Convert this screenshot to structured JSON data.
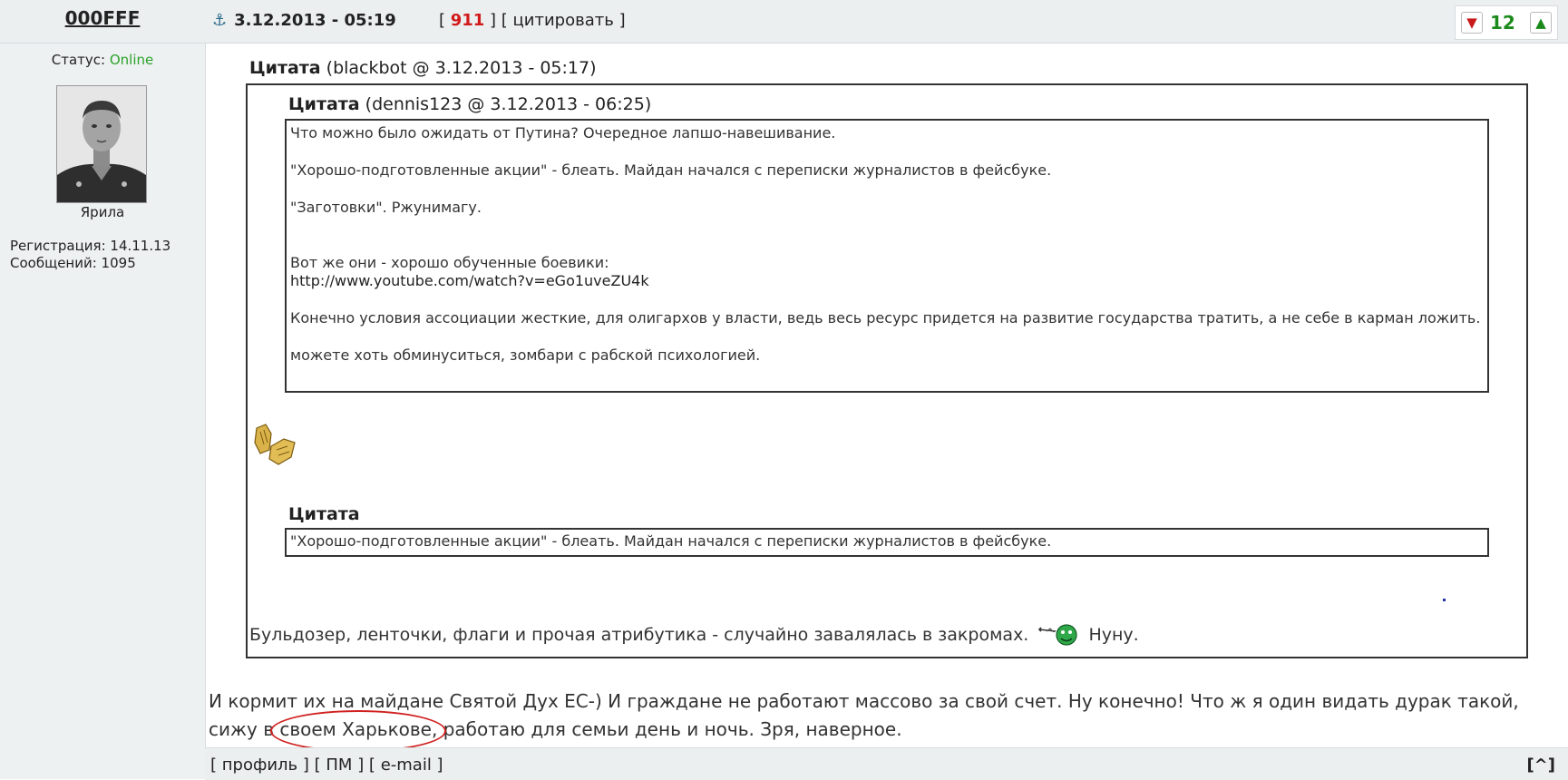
{
  "post": {
    "username": "000FFF",
    "datetime": "3.12.2013 - 05:19",
    "post_number": "911",
    "quote_label": "цитировать",
    "rating": "12"
  },
  "user": {
    "status_label": "Статус:",
    "status_value": "Online",
    "title": "Ярила",
    "registration": "Регистрация: 14.11.13",
    "messages": "Сообщений: 1095"
  },
  "quote1": {
    "title": "Цитата",
    "meta": "(blackbot @ 3.12.2013 - 05:17)",
    "after_text": "Бульдозер, ленточки, флаги и прочая атрибутика - случайно завалялась в закромах.",
    "after_text2": "Нуну."
  },
  "quote2": {
    "title": "Цитата",
    "meta": "(dennis123 @ 3.12.2013 - 06:25)",
    "p1": "Что можно было ожидать от Путина? Очередное лапшо-навешивание.",
    "p2": "\"Хорошо-подготовленные акции\" - блеать. Майдан начался с переписки журналистов в фейсбуке.",
    "p3": "\"Заготовки\". Ржунимагу.",
    "p4": "Вот же они - хорошо обученные боевики:",
    "link": "http://www.youtube.com/watch?v=eGo1uveZU4k",
    "p5": "Конечно условия ассоциации жесткие, для олигархов у власти, ведь весь ресурс придется на развитие государства тратить, а не себе в карман ложить.",
    "p6": "можете хоть обминуситься, зомбари с рабской психологией."
  },
  "quote3": {
    "title": "Цитата",
    "text": "\"Хорошо-подготовленные акции\" - блеать. Майдан начался с переписки журналистов в фейсбуке."
  },
  "main": {
    "text_before": "И кормит их на майдане Святой Дух ЕС-) И граждане не работают массово за свой счет. Ну конечно! Что ж я один видать дурак такой, сижу в ",
    "highlight": "своем Харькове,",
    "text_after": " работаю для семьи день и ночь. Зря, наверное."
  },
  "footer": {
    "profile": "профиль",
    "pm": "ПМ",
    "email": "e-mail",
    "top": "[^]"
  },
  "colors": {
    "online": "#2aa32a",
    "post_number": "#d21a1a",
    "rating": "#1a8a1a",
    "circle": "#d02020"
  }
}
